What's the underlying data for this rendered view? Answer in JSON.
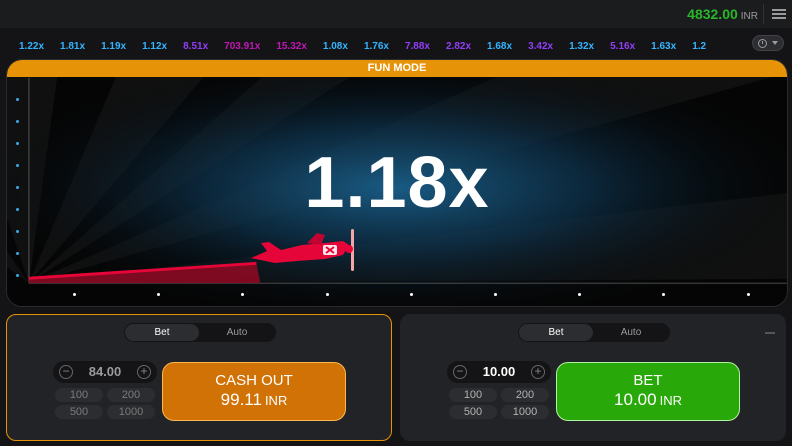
{
  "header": {
    "balance": "4832.00",
    "currency": "INR"
  },
  "history": [
    {
      "value": "1.22x",
      "tone": "blue"
    },
    {
      "value": "1.81x",
      "tone": "blue"
    },
    {
      "value": "1.19x",
      "tone": "blue"
    },
    {
      "value": "1.12x",
      "tone": "blue"
    },
    {
      "value": "8.51x",
      "tone": "purple"
    },
    {
      "value": "703.91x",
      "tone": "pink"
    },
    {
      "value": "15.32x",
      "tone": "pink"
    },
    {
      "value": "1.08x",
      "tone": "blue"
    },
    {
      "value": "1.76x",
      "tone": "blue"
    },
    {
      "value": "7.88x",
      "tone": "purple"
    },
    {
      "value": "2.82x",
      "tone": "purple"
    },
    {
      "value": "1.68x",
      "tone": "blue"
    },
    {
      "value": "3.42x",
      "tone": "purple"
    },
    {
      "value": "1.32x",
      "tone": "blue"
    },
    {
      "value": "5.16x",
      "tone": "purple"
    },
    {
      "value": "1.63x",
      "tone": "blue"
    },
    {
      "value": "1.2",
      "tone": "blue"
    }
  ],
  "game": {
    "mode_label": "FUN MODE",
    "multiplier": "1.18x"
  },
  "panels": {
    "left": {
      "tab_bet": "Bet",
      "tab_auto": "Auto",
      "amount": "84.00",
      "quick": [
        "100",
        "200",
        "500",
        "1000"
      ],
      "button_label": "CASH OUT",
      "button_amount": "99.11",
      "button_currency": "INR"
    },
    "right": {
      "tab_bet": "Bet",
      "tab_auto": "Auto",
      "amount": "10.00",
      "quick": [
        "100",
        "200",
        "500",
        "1000"
      ],
      "button_label": "BET",
      "button_amount": "10.00",
      "button_currency": "INR"
    }
  },
  "colors": {
    "accent_orange": "#e69308",
    "bet_green": "#28a909",
    "balance_green": "#28b728",
    "plane_red": "#e50539",
    "mult_blue": "#34b4ff",
    "mult_purple": "#913ef8",
    "mult_pink": "#c017b4"
  },
  "icons": {
    "menu": "hamburger-icon",
    "history": "clock-icon",
    "plane": "plane-icon"
  }
}
